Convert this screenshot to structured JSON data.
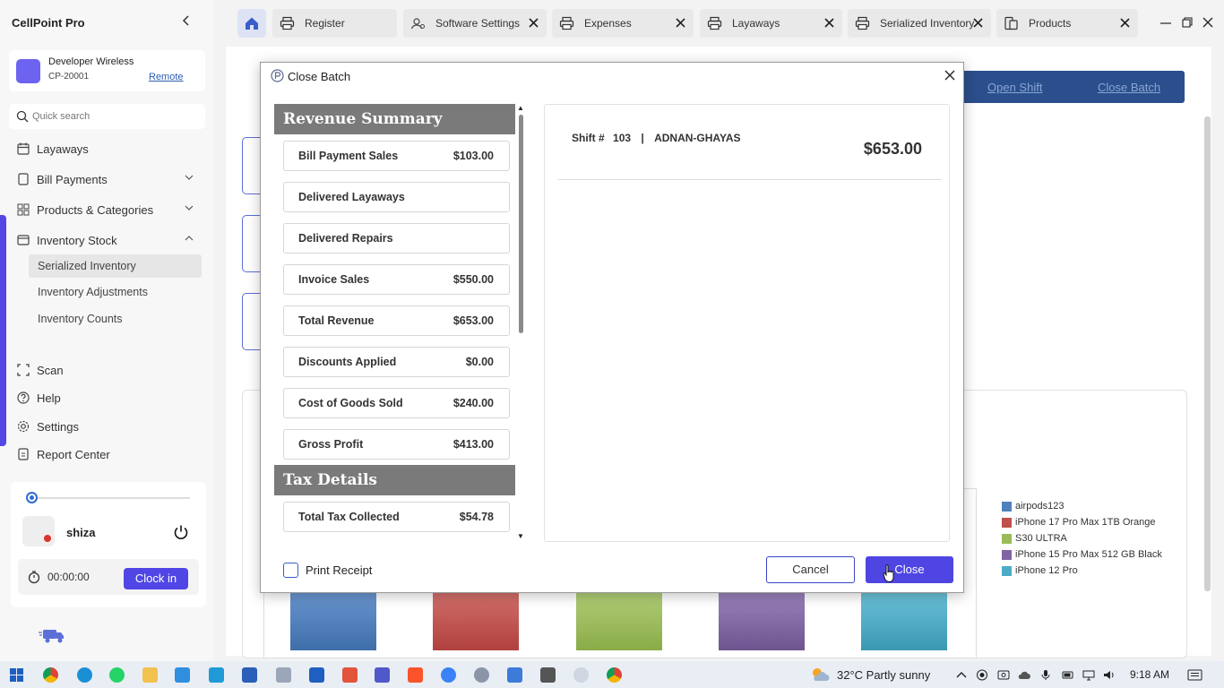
{
  "app": {
    "title": "CellPoint Pro"
  },
  "store": {
    "name": "Developer Wireless",
    "id": "CP-20001",
    "remote_label": "Remote"
  },
  "search": {
    "placeholder": "Quick search"
  },
  "sidebar": {
    "items": [
      {
        "label": "Layaways",
        "icon": "calendar-icon"
      },
      {
        "label": "Bill Payments",
        "icon": "document-icon"
      },
      {
        "label": "Products & Categories",
        "icon": "grid-icon"
      },
      {
        "label": "Inventory Stock",
        "icon": "box-icon"
      }
    ],
    "sub_items": [
      {
        "label": "Serialized Inventory",
        "active": true
      },
      {
        "label": "Inventory Adjustments"
      },
      {
        "label": "Inventory Counts"
      }
    ],
    "bottom_items": [
      {
        "label": "Scan",
        "icon": "scan-icon"
      },
      {
        "label": "Help",
        "icon": "help-icon"
      },
      {
        "label": "Settings",
        "icon": "gear-icon"
      },
      {
        "label": "Report Center",
        "icon": "report-icon"
      }
    ]
  },
  "user": {
    "name": "shiza",
    "timer": "00:00:00",
    "clock_in_label": "Clock in"
  },
  "tabs": [
    {
      "label": "Register",
      "icon": "printer-icon"
    },
    {
      "label": "Software Settings",
      "icon": "settings-icon"
    },
    {
      "label": "Expenses",
      "icon": "printer-icon"
    },
    {
      "label": "Layaways",
      "icon": "printer-icon"
    },
    {
      "label": "Serialized Inventory",
      "icon": "printer-icon"
    },
    {
      "label": "Products",
      "icon": "products-icon"
    }
  ],
  "background": {
    "open_shift_label": "Open Shift",
    "close_batch_label": "Close Batch",
    "legend": [
      {
        "label": "airpods123",
        "color": "#4f81bd"
      },
      {
        "label": "iPhone 17 Pro Max 1TB Orange",
        "color": "#c0504d"
      },
      {
        "label": "S30 ULTRA",
        "color": "#9bbb59"
      },
      {
        "label": "iPhone 15 Pro Max 512 GB Black",
        "color": "#8064a2"
      },
      {
        "label": "iPhone 12 Pro",
        "color": "#4bacc6"
      }
    ]
  },
  "modal": {
    "title": "Close Batch",
    "revenue_heading": "Revenue Summary",
    "rows": [
      {
        "label": "Bill Payment Sales",
        "value": "$103.00"
      },
      {
        "label": "Delivered Layaways",
        "value": ""
      },
      {
        "label": "Delivered Repairs",
        "value": ""
      },
      {
        "label": "Invoice Sales",
        "value": "$550.00"
      },
      {
        "label": "Total Revenue",
        "value": "$653.00"
      },
      {
        "label": "Discounts Applied",
        "value": "$0.00"
      },
      {
        "label": "Cost of Goods Sold",
        "value": "$240.00"
      },
      {
        "label": "Gross Profit",
        "value": "$413.00"
      }
    ],
    "tax_heading": "Tax Details",
    "tax_rows": [
      {
        "label": "Total Tax Collected",
        "value": "$54.78"
      }
    ],
    "shift_label": "Shift #",
    "shift_number": "103",
    "shift_separator": "|",
    "shift_user": "ADNAN-GHAYAS",
    "shift_total": "$653.00",
    "print_receipt_label": "Print Receipt",
    "print_receipt_checked": false,
    "cancel_label": "Cancel",
    "close_label": "Close"
  },
  "taskbar": {
    "weather": "32°C  Partly sunny",
    "time": "9:18 AM"
  },
  "colors": {
    "accent": "#5046e5",
    "section_header": "#7a7a7a",
    "top_bar": "#2a4f8c"
  }
}
